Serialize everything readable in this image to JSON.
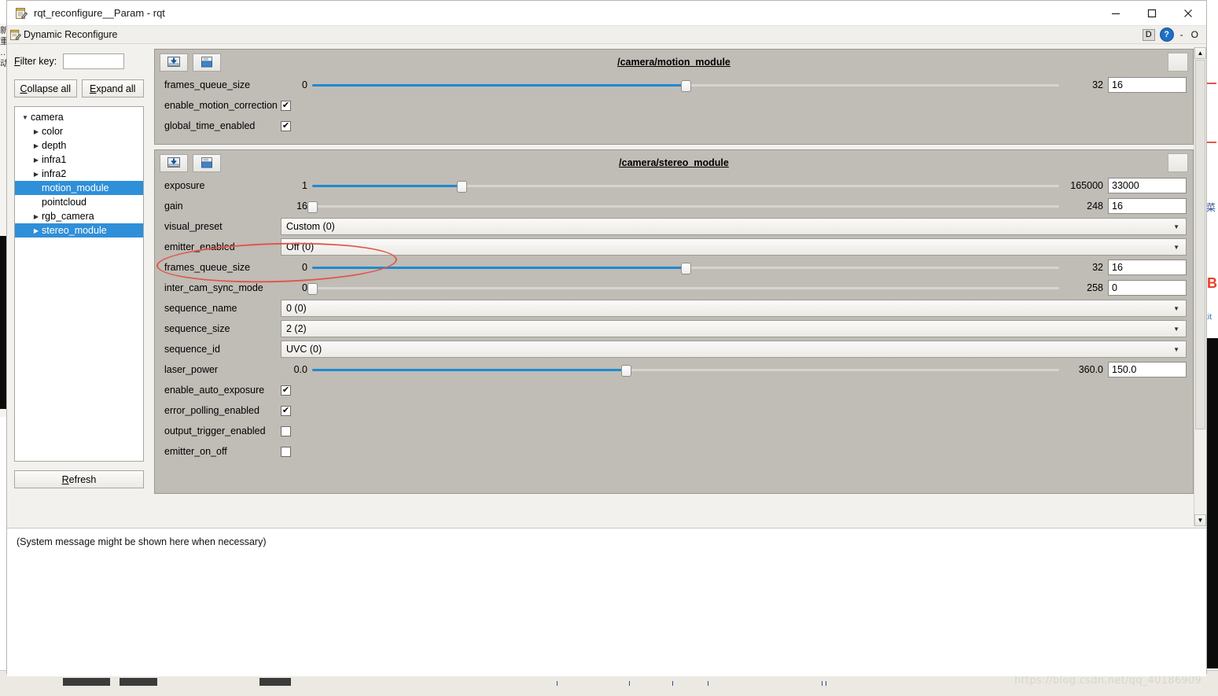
{
  "window": {
    "title": "rqt_reconfigure__Param - rqt",
    "title_icon": "notepad-icon",
    "minimize": "—",
    "maximize": "▢",
    "close": "✕"
  },
  "plugin": {
    "icon": "notepad-icon",
    "title": "Dynamic Reconfigure",
    "dock_label": "D",
    "help_label": "?",
    "minimize_label": "-",
    "float_label": "O"
  },
  "sidebar": {
    "filter_label": "Filter key:",
    "filter_value": "",
    "filter_placeholder": "",
    "collapse_all": "Collapse all",
    "expand_all": "Expand all",
    "refresh": "Refresh",
    "tree": [
      {
        "label": "camera",
        "depth": 0,
        "arrow": "▼",
        "selected": false
      },
      {
        "label": "color",
        "depth": 1,
        "arrow": "▶",
        "selected": false
      },
      {
        "label": "depth",
        "depth": 1,
        "arrow": "▶",
        "selected": false
      },
      {
        "label": "infra1",
        "depth": 1,
        "arrow": "▶",
        "selected": false
      },
      {
        "label": "infra2",
        "depth": 1,
        "arrow": "▶",
        "selected": false
      },
      {
        "label": "motion_module",
        "depth": 1,
        "arrow": "",
        "selected": true
      },
      {
        "label": "pointcloud",
        "depth": 1,
        "arrow": "",
        "selected": false
      },
      {
        "label": "rgb_camera",
        "depth": 1,
        "arrow": "▶",
        "selected": false
      },
      {
        "label": "stereo_module",
        "depth": 1,
        "arrow": "▶",
        "selected": true
      }
    ]
  },
  "groups": [
    {
      "title": "/camera/motion_module",
      "load_icon": "load-config-icon",
      "save_icon": "save-config-icon",
      "params": [
        {
          "kind": "slider",
          "name": "frames_queue_size",
          "min": "0",
          "max": "32",
          "value": "16",
          "fill_pct": 50
        },
        {
          "kind": "check",
          "name": "enable_motion_correction",
          "checked": true,
          "mark": "✔"
        },
        {
          "kind": "check",
          "name": "global_time_enabled",
          "checked": true,
          "mark": "✔"
        }
      ]
    },
    {
      "title": "/camera/stereo_module",
      "load_icon": "load-config-icon",
      "save_icon": "save-config-icon",
      "params": [
        {
          "kind": "slider",
          "name": "exposure",
          "min": "1",
          "max": "165000",
          "value": "33000",
          "fill_pct": 20
        },
        {
          "kind": "slider",
          "name": "gain",
          "min": "16",
          "max": "248",
          "value": "16",
          "fill_pct": 0
        },
        {
          "kind": "combo",
          "name": "visual_preset",
          "value": "Custom (0)",
          "caret": "▼"
        },
        {
          "kind": "combo",
          "name": "emitter_enabled",
          "value": "Off (0)",
          "caret": "▼"
        },
        {
          "kind": "slider",
          "name": "frames_queue_size",
          "min": "0",
          "max": "32",
          "value": "16",
          "fill_pct": 50
        },
        {
          "kind": "slider",
          "name": "inter_cam_sync_mode",
          "min": "0",
          "max": "258",
          "value": "0",
          "fill_pct": 0
        },
        {
          "kind": "combo",
          "name": "sequence_name",
          "value": "0 (0)",
          "caret": "▼"
        },
        {
          "kind": "combo",
          "name": "sequence_size",
          "value": "2 (2)",
          "caret": "▼"
        },
        {
          "kind": "combo",
          "name": "sequence_id",
          "value": "UVC (0)",
          "caret": "▼"
        },
        {
          "kind": "slider",
          "name": "laser_power",
          "min": "0.0",
          "max": "360.0",
          "value": "150.0",
          "fill_pct": 42
        },
        {
          "kind": "check",
          "name": "enable_auto_exposure",
          "checked": true,
          "mark": "✔"
        },
        {
          "kind": "check",
          "name": "error_polling_enabled",
          "checked": true,
          "mark": "✔"
        },
        {
          "kind": "check",
          "name": "output_trigger_enabled",
          "checked": false,
          "mark": ""
        },
        {
          "kind": "check",
          "name": "emitter_on_off",
          "checked": false,
          "mark": ""
        }
      ]
    }
  ],
  "status": {
    "message": "(System message might be shown here when necessary)"
  },
  "annotation": {
    "shape": "red-ellipse",
    "target": "emitter_enabled",
    "color": "#e0574b"
  },
  "desktop": {
    "watermark": "https://blog.csdn.net/qq_40186909",
    "left_cjk": "新 重 … 动",
    "right_glyph": "菜",
    "right_orange": "B",
    "right_blue": "xit"
  },
  "scrollbar": {
    "up_arrow": "▲",
    "down_arrow": "▼"
  }
}
